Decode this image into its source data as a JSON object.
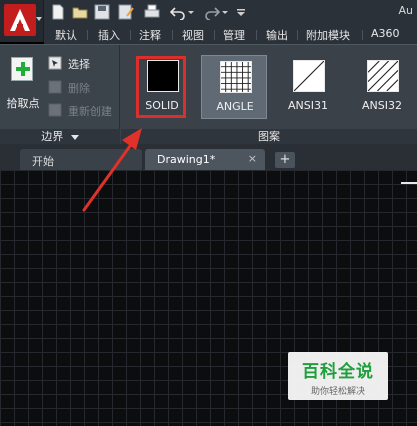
{
  "title_partial": "Au",
  "quick_access": {
    "icons": [
      "new-file-icon",
      "open-file-icon",
      "save-icon",
      "save-as-icon",
      "print-icon",
      "undo-icon",
      "redo-icon",
      "customize-icon"
    ]
  },
  "ribbon_tabs": [
    "默认",
    "插入",
    "注释",
    "视图",
    "管理",
    "输出",
    "附加模块",
    "A360"
  ],
  "boundary_panel": {
    "pick_points_label": "拾取点",
    "select_label": "选择",
    "remove_label": "删除",
    "recreate_label": "重新创建",
    "title": "边界"
  },
  "pattern_panel": {
    "patterns": [
      "SOLID",
      "ANGLE",
      "ANSI31",
      "ANSI32"
    ],
    "selected_pattern": "ANGLE",
    "highlighted_pattern": "SOLID",
    "title": "图案"
  },
  "doc_tabs": {
    "start_label": "开始",
    "active_label": "Drawing1*",
    "close_symbol": "×",
    "new_tab_symbol": "+"
  },
  "watermark": {
    "title": "百科全说",
    "subtitle": "助你轻松解决"
  },
  "colors": {
    "highlight": "#d9302b",
    "brand_red": "#c41d1d",
    "watermark_green": "#1f9e3c"
  }
}
